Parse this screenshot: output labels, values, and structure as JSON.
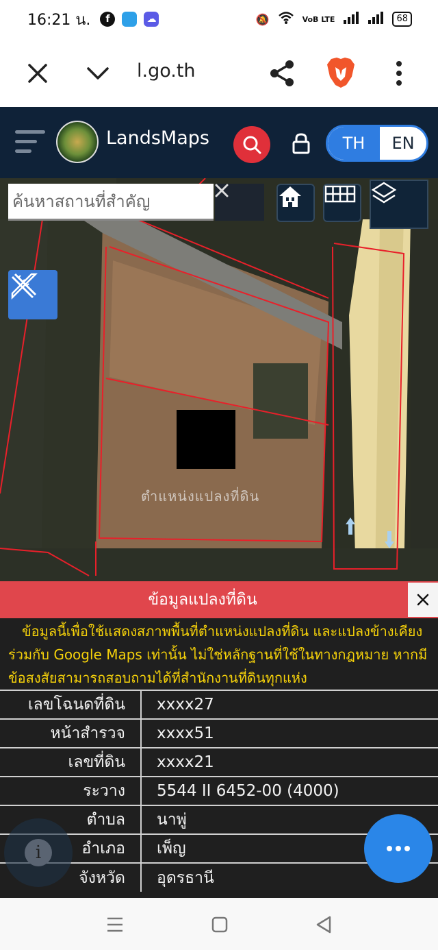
{
  "status_bar": {
    "time": "16:21 น.",
    "battery": "68",
    "network": "VoB LTE"
  },
  "browser": {
    "url": "l.go.th"
  },
  "header": {
    "brand": "LandsMaps",
    "lang_th": "TH",
    "lang_en": "EN",
    "accent_color": "#2f7de1",
    "search_color": "#e0303a"
  },
  "map": {
    "search_placeholder": "ค้นหาสถานที่สำคัญ",
    "label": "ตำแหน่งแปลงที่ดิน"
  },
  "panel": {
    "title": "ข้อมูลแปลงที่ดิน",
    "disclaimer": "ข้อมูลนี้เพื่อใช้แสดงสภาพพื้นที่ตำแหน่งแปลงที่ดิน และแปลงข้างเคียงร่วมกับ Google Maps เท่านั้น ไม่ใช่หลักฐานที่ใช้ในทางกฎหมาย หากมีข้อสงสัยสามารถสอบถามได้ที่สำนักงานที่ดินทุกแห่ง",
    "rows": [
      {
        "key": "เลขโฉนดที่ดิน",
        "value": "xxxx27"
      },
      {
        "key": "หน้าสำรวจ",
        "value": "xxxx51"
      },
      {
        "key": "เลขที่ดิน",
        "value": "xxxx21"
      },
      {
        "key": "ระวาง",
        "value": "5544 II 6452-00 (4000)"
      },
      {
        "key": "ตำบล",
        "value": "นาพู่"
      },
      {
        "key": "อำเภอ",
        "value": "เพ็ญ"
      },
      {
        "key": "จังหวัด",
        "value": "อุดรธานี"
      }
    ]
  }
}
